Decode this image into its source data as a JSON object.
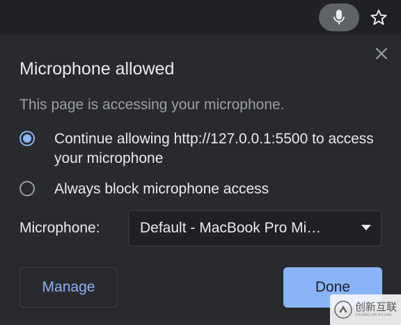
{
  "toolbar": {
    "mic_icon": "microphone-icon",
    "star_icon": "star-outline-icon"
  },
  "dialog": {
    "title": "Microphone allowed",
    "subtitle": "This page is accessing your microphone.",
    "close_icon": "close-icon",
    "options": [
      {
        "label": "Continue allowing http://127.0.0.1:5500 to access your microphone",
        "checked": true
      },
      {
        "label": "Always block microphone access",
        "checked": false
      }
    ],
    "microphone_label": "Microphone:",
    "microphone_select": {
      "value": "Default - MacBook Pro Mi…"
    },
    "manage_label": "Manage",
    "done_label": "Done"
  },
  "watermark": {
    "text_cn": "创新互联",
    "text_en": "CHUANG XIN HU LIAN"
  },
  "colors": {
    "background": "#292a2d",
    "toolbar_bg": "#202124",
    "accent": "#8ab4f8",
    "text_primary": "#e8eaed",
    "text_secondary": "#9aa0a6"
  }
}
